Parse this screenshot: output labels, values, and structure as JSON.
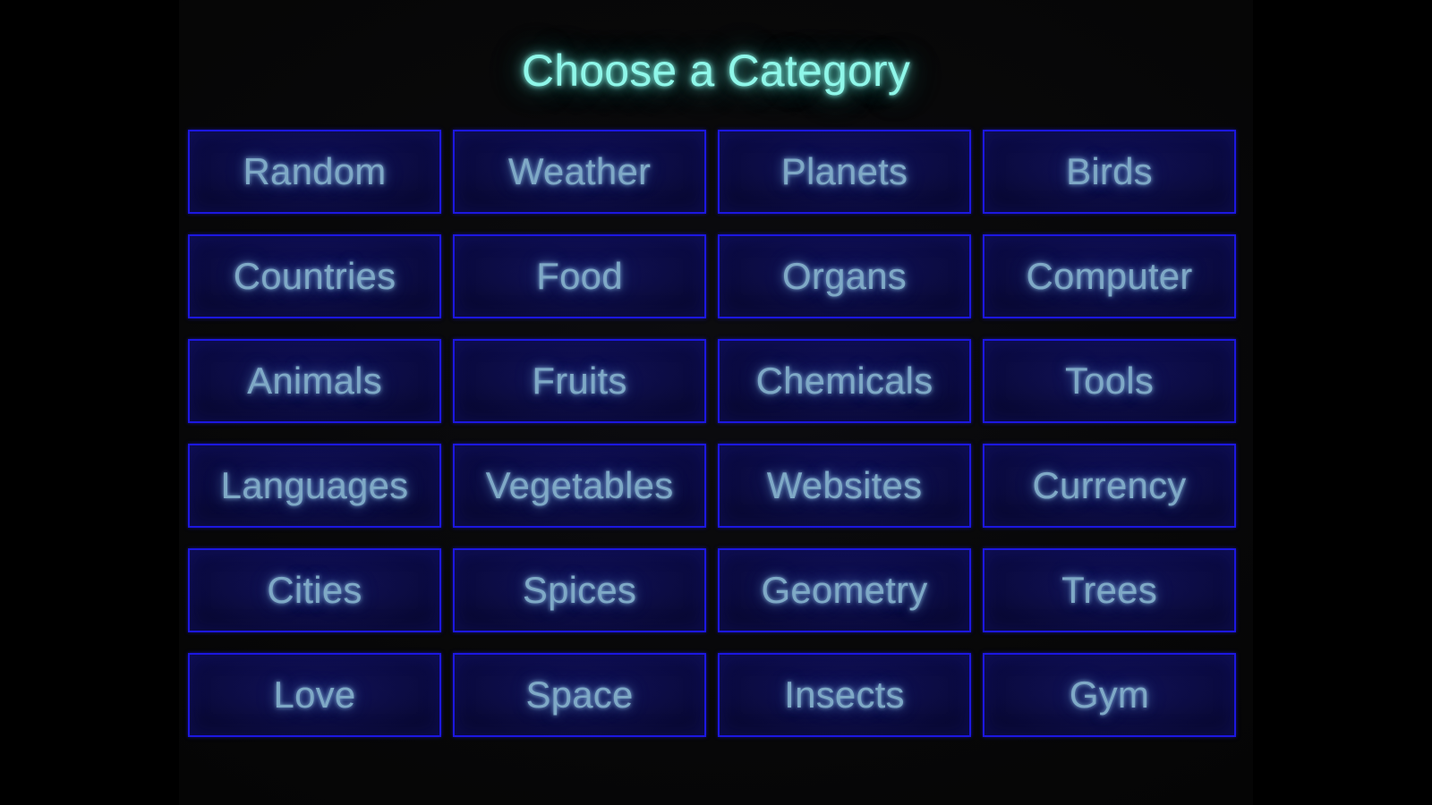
{
  "screen": {
    "title": "Choose a Category",
    "background_color": "#000000",
    "stage_background_color": "#070707"
  },
  "theme": {
    "title_color": "#8ff7e9",
    "button_fill": "#0a0a3e",
    "button_border": "#1c17e0",
    "button_text_color": "#7fa9c6"
  },
  "grid": {
    "columns": 4,
    "rows": 6,
    "buttons": [
      {
        "label": "Random"
      },
      {
        "label": "Weather"
      },
      {
        "label": "Planets"
      },
      {
        "label": "Birds"
      },
      {
        "label": "Countries"
      },
      {
        "label": "Food"
      },
      {
        "label": "Organs"
      },
      {
        "label": "Computer"
      },
      {
        "label": "Animals"
      },
      {
        "label": "Fruits"
      },
      {
        "label": "Chemicals"
      },
      {
        "label": "Tools"
      },
      {
        "label": "Languages"
      },
      {
        "label": "Vegetables"
      },
      {
        "label": "Websites"
      },
      {
        "label": "Currency"
      },
      {
        "label": "Cities"
      },
      {
        "label": "Spices"
      },
      {
        "label": "Geometry"
      },
      {
        "label": "Trees"
      },
      {
        "label": "Love"
      },
      {
        "label": "Space"
      },
      {
        "label": "Insects"
      },
      {
        "label": "Gym"
      }
    ]
  }
}
